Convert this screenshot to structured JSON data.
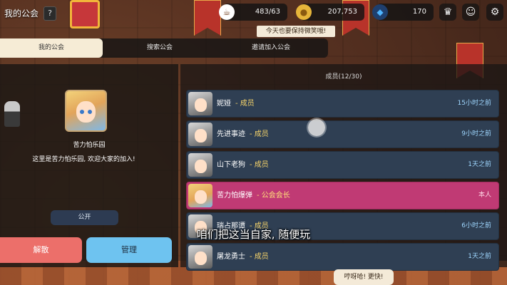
{
  "header": {
    "title": "我的公会",
    "help_label": "?",
    "resources": [
      {
        "icon": "coffee-cup-icon",
        "value": "483/63"
      },
      {
        "icon": "gold-coin-icon",
        "value": "207,753"
      },
      {
        "icon": "diamond-icon",
        "value": "170"
      }
    ],
    "notice_text": "今天也要保持微笑哦!"
  },
  "tabs": [
    {
      "label": "我的公会",
      "active": true
    },
    {
      "label": "搜索公会",
      "active": false
    },
    {
      "label": "邀请加入公会",
      "active": false
    }
  ],
  "guild": {
    "name": "苦力怕乐园",
    "description": "这里是苦力怕乐园, 欢迎大家的加入!",
    "public_label": "公开",
    "dismiss_label": "解散",
    "manage_label": "管理"
  },
  "members": {
    "header": "成员(12/30)",
    "list": [
      {
        "name": "妮娅",
        "role": "- 成员",
        "time": "15小时之前",
        "leader": false
      },
      {
        "name": "先进事迹",
        "role": "- 成员",
        "time": "9小时之前",
        "leader": false
      },
      {
        "name": "山下老狗",
        "role": "- 成员",
        "time": "1天之前",
        "leader": false
      },
      {
        "name": "苦力怕爆弹",
        "role": "- 公会会长",
        "time": "本人",
        "leader": true
      },
      {
        "name": "瑞占那谭",
        "role": "- 成员",
        "time": "6小时之前",
        "leader": false
      },
      {
        "name": "屠龙勇士",
        "role": "- 成员",
        "time": "1天之前",
        "leader": false
      }
    ]
  },
  "subtitle": "咱们把这当自家, 随便玩",
  "speech_bubble": "哼呀哈! 更快!",
  "colors": {
    "leader_row": "#c03a74",
    "member_row": "#2f3f53",
    "dismiss": "#ec6f6a",
    "manage": "#6ec3f0"
  }
}
